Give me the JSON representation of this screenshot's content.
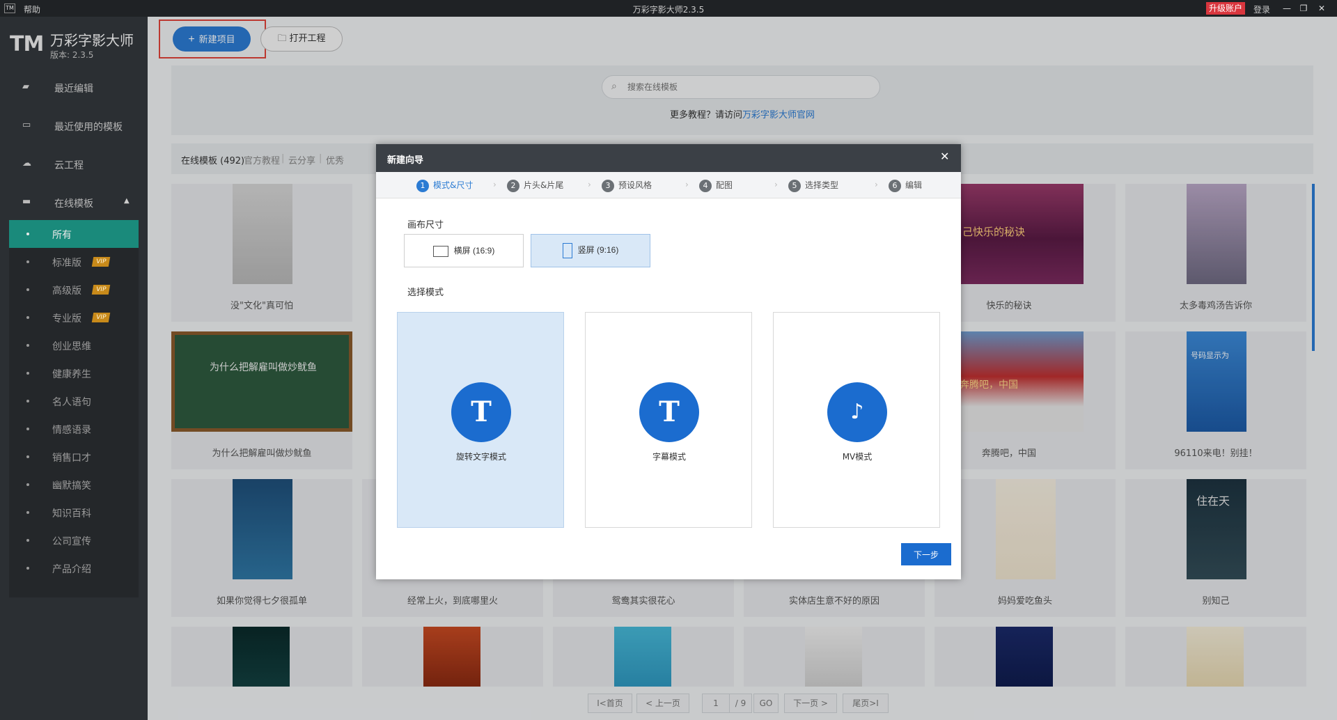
{
  "titlebar": {
    "logo": "TM",
    "help": "帮助",
    "title": "万彩字影大师2.3.5",
    "upgrade": "升级账户",
    "login": "登录",
    "minimize": "—",
    "restore": "❐",
    "close": "✕"
  },
  "brand": {
    "logo": "TM",
    "name": "万彩字影大师",
    "version": "版本: 2.3.5"
  },
  "nav": {
    "recent_edit": "最近编辑",
    "recent_templates": "最近使用的模板",
    "cloud": "云工程",
    "online": "在线模板"
  },
  "categories": [
    {
      "label": "所有",
      "vip": ""
    },
    {
      "label": "标准版",
      "vip": "VIP"
    },
    {
      "label": "高级版",
      "vip": "VIP"
    },
    {
      "label": "专业版",
      "vip": "VIP"
    },
    {
      "label": "创业思维",
      "vip": ""
    },
    {
      "label": "健康养生",
      "vip": ""
    },
    {
      "label": "名人语句",
      "vip": ""
    },
    {
      "label": "情感语录",
      "vip": ""
    },
    {
      "label": "销售口才",
      "vip": ""
    },
    {
      "label": "幽默搞笑",
      "vip": ""
    },
    {
      "label": "知识百科",
      "vip": ""
    },
    {
      "label": "公司宣传",
      "vip": ""
    },
    {
      "label": "产品介绍",
      "vip": ""
    }
  ],
  "toolbar": {
    "new_project": "新建项目",
    "open_project": "打开工程"
  },
  "search": {
    "placeholder": "搜索在线模板",
    "tutorial_prefix": "更多教程？请访问",
    "tutorial_link": "万彩字影大师官网"
  },
  "tabs": {
    "online": "在线模板 (492)",
    "official": "官方教程",
    "cloud_share": "云分享",
    "excellent": "优秀"
  },
  "cards": {
    "c1": "没\"文化\"真可怕",
    "c2": "快乐的秘诀",
    "c3": "太多毒鸡汤告诉你",
    "c4": "为什么把解雇叫做炒鱿鱼",
    "c5": "奔腾吧，中国",
    "c6": "96110来电！别挂！",
    "c7": "如果你觉得七夕很孤单",
    "c8": "经常上火，到底哪里火",
    "c9": "鸳鸯其实很花心",
    "c10": "实体店生意不好的原因",
    "c11": "妈妈爱吃鱼头",
    "c12": "别知己"
  },
  "thumbs": {
    "t1": "为什么把解雇叫做炒鱿鱼",
    "t2": "让自己快乐的秘诀",
    "t3": "奔腾吧，中国",
    "t4": "号码显示为",
    "t5": "住在天"
  },
  "pager": {
    "first": "I<首页",
    "prev": "< 上一页",
    "current": "1",
    "total": "/ 9",
    "go": "GO",
    "next": "下一页 >",
    "last": "尾页>I"
  },
  "dialog": {
    "title": "新建向导",
    "close": "✕",
    "steps": [
      {
        "num": "1",
        "label": "模式&尺寸"
      },
      {
        "num": "2",
        "label": "片头&片尾"
      },
      {
        "num": "3",
        "label": "预设风格"
      },
      {
        "num": "4",
        "label": "配图"
      },
      {
        "num": "5",
        "label": "选择类型"
      },
      {
        "num": "6",
        "label": "编辑"
      }
    ],
    "canvas_label": "画布尺寸",
    "landscape": "横屏 (16:9)",
    "portrait": "竖屏 (9:16)",
    "mode_label": "选择模式",
    "modes": [
      {
        "label": "旋转文字模式",
        "glyph": "T"
      },
      {
        "label": "字幕模式",
        "glyph": "T"
      },
      {
        "label": "MV模式",
        "glyph": "♪"
      }
    ],
    "next": "下一步"
  }
}
